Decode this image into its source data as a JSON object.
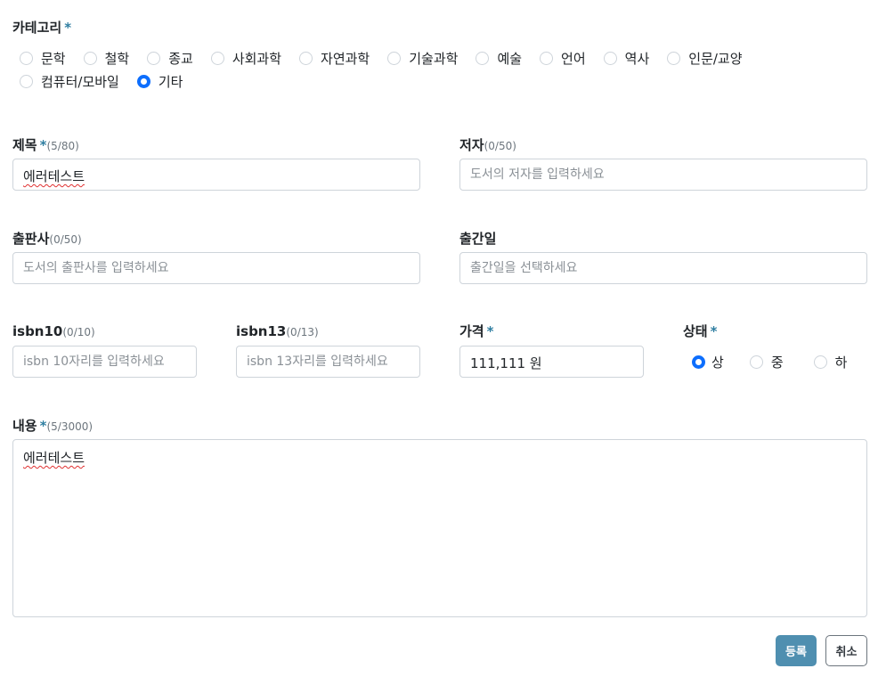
{
  "category": {
    "label": "카테고리",
    "required": "*",
    "options": [
      "문학",
      "철학",
      "종교",
      "사회과학",
      "자연과학",
      "기술과학",
      "예술",
      "언어",
      "역사",
      "인문/교양",
      "컴퓨터/모바일",
      "기타"
    ],
    "selected": "기타"
  },
  "title": {
    "label": "제목",
    "required": "*",
    "count": "(5/80)",
    "value": "에러테스트"
  },
  "author": {
    "label": "저자",
    "count": "(0/50)",
    "placeholder": "도서의 저자를 입력하세요"
  },
  "publisher": {
    "label": "출판사",
    "count": "(0/50)",
    "placeholder": "도서의 출판사를 입력하세요"
  },
  "pub_date": {
    "label": "출간일",
    "placeholder": "출간일을 선택하세요"
  },
  "isbn10": {
    "label": "isbn10",
    "count": "(0/10)",
    "placeholder": "isbn 10자리를 입력하세요"
  },
  "isbn13": {
    "label": "isbn13",
    "count": "(0/13)",
    "placeholder": "isbn 13자리를 입력하세요"
  },
  "price": {
    "label": "가격",
    "required": "*",
    "value": "111,111 원"
  },
  "condition": {
    "label": "상태",
    "required": "*",
    "options": [
      "상",
      "중",
      "하"
    ],
    "selected": "상"
  },
  "content": {
    "label": "내용",
    "required": "*",
    "count": "(5/3000)",
    "value": "에러테스트"
  },
  "buttons": {
    "submit": "등록",
    "cancel": "취소"
  },
  "colors": {
    "accent": "#0d6efd",
    "primary_button": "#4f8fb0",
    "required": "#2f7ea1"
  }
}
